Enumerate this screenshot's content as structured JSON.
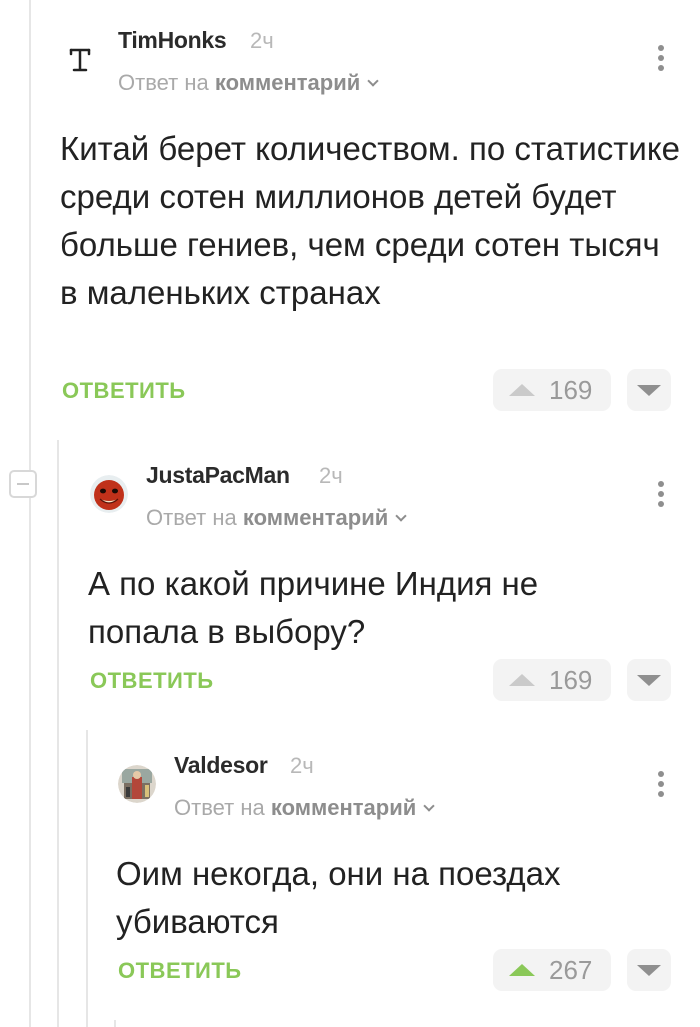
{
  "comments": [
    {
      "author": "TimHonks",
      "time": "2ч",
      "reply_prefix": "Ответ на",
      "reply_target": "комментарий",
      "text": "Китай берет количеством. по статистике среди сотен миллионов детей будет больше гениев, чем среди сотен тысяч в маленьких странах",
      "reply_label": "ответить",
      "rating": "169",
      "avatar_letter": "T"
    },
    {
      "author": "JustaPacMan",
      "time": "2ч",
      "reply_prefix": "Ответ на",
      "reply_target": "комментарий",
      "text": "А по какой причине Индия не попала в выбору?",
      "reply_label": "ответить",
      "rating": "169"
    },
    {
      "author": "Valdesor",
      "time": "2ч",
      "reply_prefix": "Ответ на",
      "reply_target": "комментарий",
      "text": "Оим некогда, они на поездах убиваются",
      "reply_label": "ответить",
      "rating": "267"
    }
  ],
  "colors": {
    "accent_green": "#8ac858",
    "thread_line": "#e6e6e6",
    "vote_bg": "#f3f3f3"
  },
  "icons": [
    "more-vertical-icon",
    "chevron-down-icon",
    "arrow-up-icon",
    "arrow-down-icon",
    "collapse-minus-icon"
  ]
}
